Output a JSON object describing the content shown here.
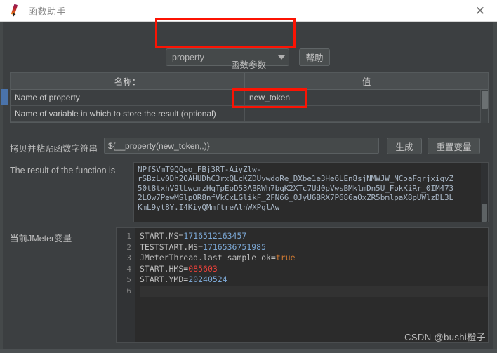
{
  "window": {
    "title": "函数助手",
    "icon": "quill-pen-icon",
    "close_label": "✕"
  },
  "toolbar": {
    "function_combo": {
      "selected": "property",
      "arrow_icon": "chevron-down-icon"
    },
    "help_label": "帮助"
  },
  "parameters_section": {
    "heading": "函数参数",
    "columns": [
      "名称：",
      "值"
    ],
    "rows": [
      {
        "name": "Name of property",
        "value": "new_token"
      },
      {
        "name": "Name of variable in which to store the result (optional)",
        "value": ""
      }
    ]
  },
  "function_string": {
    "label": "拷贝并粘贴函数字符串",
    "value": "${__property(new_token,,)}",
    "placeholder": "",
    "generate_label": "生成",
    "reset_label": "重置变量"
  },
  "result": {
    "label": "The result of the function is",
    "text": "NPfSVmT9QQeo_FBj3RT-AiyZlw-\nrSBzLv0Dh2OAHUDhC3rxQLcKZDUvwdoRe_DXbe1e3He6LEn8sjNMWJW_NCoaFqrjxiqvZ\n50t8txhV9lLwcmzHqTpEoD53ABRWh7bqK2XTc7Ud0pVwsBMklmDn5U_FokKiRr_0IM473\n2LOw7PewMSlpOR8nfVkCxLGlikF_2FN66_0JyU6BRX7P686aOxZR5bmlpaX8pUWlzDL3L\nKmL9yt8Y.I4KiyQMmftreAlnWXPglAw"
  },
  "variables": {
    "label": "当前JMeter变量",
    "line_numbers": "1\n2\n3\n4\n5\n6",
    "lines": [
      {
        "num": "1",
        "key": "START.MS=",
        "value": "1716512163457",
        "value_kind": "num"
      },
      {
        "num": "2",
        "key": "TESTSTART.MS=",
        "value": "1716536751985",
        "value_kind": "num"
      },
      {
        "num": "3",
        "key": "JMeterThread.last_sample_ok=",
        "value": "true",
        "value_kind": "bool"
      },
      {
        "num": "4",
        "key": "START.HMS=",
        "value": "085603",
        "value_kind": "sel"
      },
      {
        "num": "5",
        "key": "START.YMD=",
        "value": "20240524",
        "value_kind": "num"
      },
      {
        "num": "6",
        "key": "",
        "value": "",
        "value_kind": "num"
      }
    ]
  },
  "annotations": {
    "highlight_color": "#fc1303",
    "boxes": [
      "function-combo-highlight",
      "property-value-highlight"
    ]
  },
  "watermark": {
    "text": "CSDN @bushi橙子"
  },
  "colors": {
    "window_bg": "#3c3f41",
    "titlebar_bg": "#ffffff",
    "editor_bg": "#2b2b2b",
    "accent_blue": "#4a73ab",
    "code_num": "#7ba7d4",
    "code_bool": "#cc7832",
    "code_selected": "#e8413a"
  }
}
